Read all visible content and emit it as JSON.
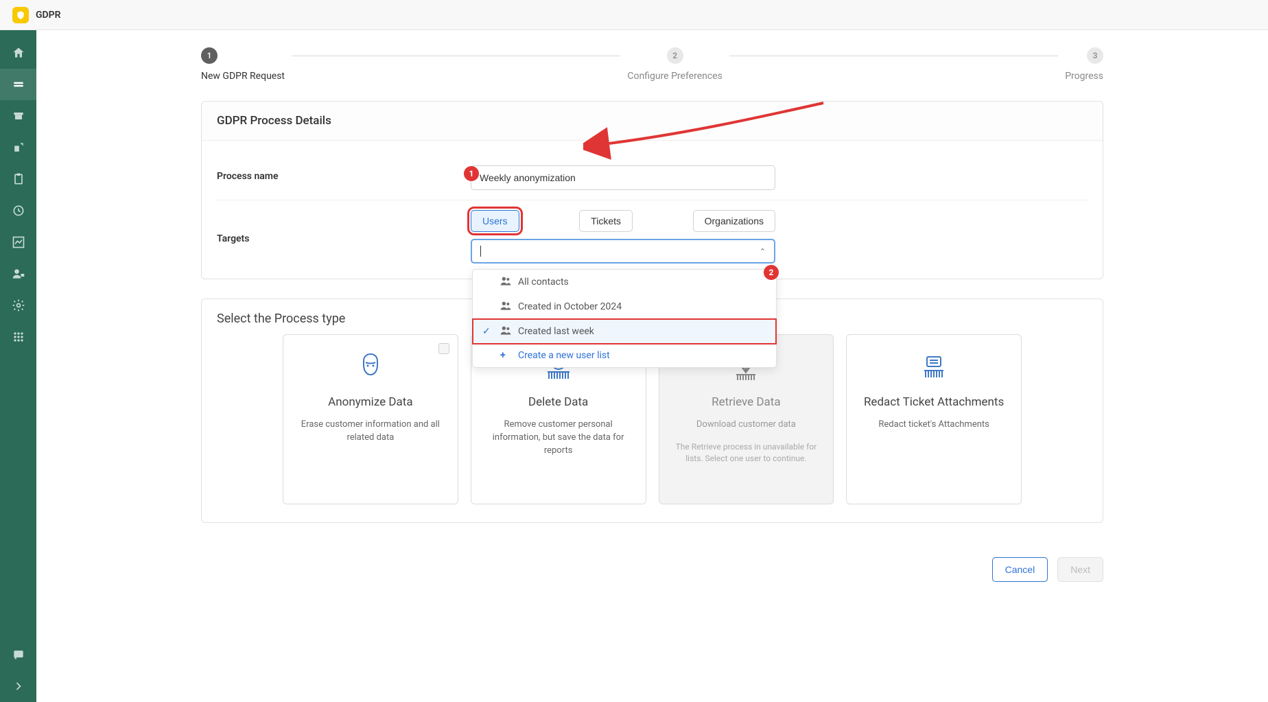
{
  "app_title": "GDPR",
  "stepper": {
    "steps": [
      {
        "num": "1",
        "label": "New GDPR Request",
        "active": true
      },
      {
        "num": "2",
        "label": "Configure Preferences",
        "active": false
      },
      {
        "num": "3",
        "label": "Progress",
        "active": false
      }
    ]
  },
  "details_card": {
    "title": "GDPR Process Details",
    "process_name_label": "Process name",
    "process_name_value": "Weekly anonymization",
    "targets_label": "Targets",
    "target_buttons": {
      "users": "Users",
      "tickets": "Tickets",
      "organizations": "Organizations"
    },
    "dropdown": {
      "options": [
        {
          "label": "All contacts"
        },
        {
          "label": "Created in October 2024"
        },
        {
          "label": "Created last week",
          "selected": true
        }
      ],
      "create_new": "Create a new user list"
    }
  },
  "process_section": {
    "title": "Select the Process type",
    "cards": [
      {
        "title": "Anonymize Data",
        "desc": "Erase customer information and all related data"
      },
      {
        "title": "Delete Data",
        "desc": "Remove customer personal information, but save the data for reports"
      },
      {
        "title": "Retrieve Data",
        "desc": "Download customer data",
        "note": "The Retrieve process in unavailable for lists. Select one user to continue.",
        "disabled": true
      },
      {
        "title": "Redact Ticket Attachments",
        "desc": "Redact ticket's Attachments"
      }
    ]
  },
  "footer": {
    "cancel": "Cancel",
    "next": "Next"
  },
  "annotations": {
    "badge1": "1",
    "badge2": "2"
  }
}
